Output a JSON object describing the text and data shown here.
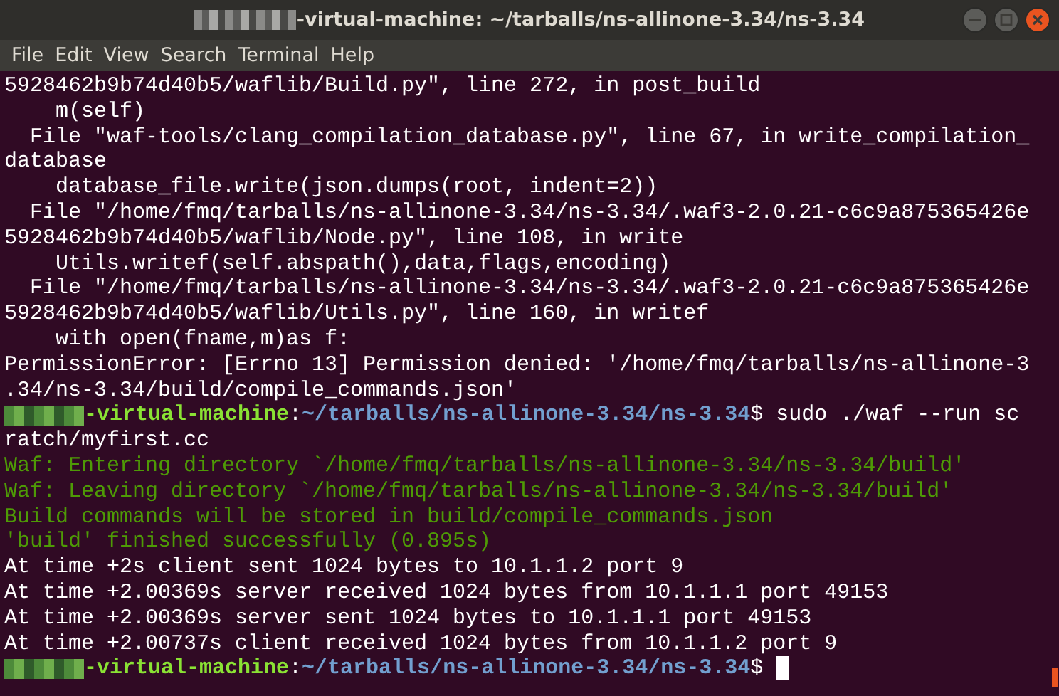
{
  "window": {
    "title": "-virtual-machine: ~/tarballs/ns-allinone-3.34/ns-3.34"
  },
  "menu": [
    "File",
    "Edit",
    "View",
    "Search",
    "Terminal",
    "Help"
  ],
  "terminal": {
    "lines": [
      {
        "kind": "output",
        "text": "5928462b9b74d40b5/waflib/Build.py\", line 272, in post_build"
      },
      {
        "kind": "output",
        "text": "    m(self)"
      },
      {
        "kind": "output",
        "text": "  File \"waf-tools/clang_compilation_database.py\", line 67, in write_compilation_"
      },
      {
        "kind": "output",
        "text": "database"
      },
      {
        "kind": "output",
        "text": "    database_file.write(json.dumps(root, indent=2))"
      },
      {
        "kind": "output",
        "text": "  File \"/home/fmq/tarballs/ns-allinone-3.34/ns-3.34/.waf3-2.0.21-c6c9a875365426e"
      },
      {
        "kind": "output",
        "text": "5928462b9b74d40b5/waflib/Node.py\", line 108, in write"
      },
      {
        "kind": "output",
        "text": "    Utils.writef(self.abspath(),data,flags,encoding)"
      },
      {
        "kind": "output",
        "text": "  File \"/home/fmq/tarballs/ns-allinone-3.34/ns-3.34/.waf3-2.0.21-c6c9a875365426e"
      },
      {
        "kind": "output",
        "text": "5928462b9b74d40b5/waflib/Utils.py\", line 160, in writef"
      },
      {
        "kind": "output",
        "text": "    with open(fname,m)as f:"
      },
      {
        "kind": "output",
        "text": "PermissionError: [Errno 13] Permission denied: '/home/fmq/tarballs/ns-allinone-3"
      },
      {
        "kind": "output",
        "text": ".34/ns-3.34/build/compile_commands.json'"
      },
      {
        "kind": "prompt",
        "host": "-virtual-machine",
        "separator": ":",
        "path": "~/tarballs/ns-allinone-3.34/ns-3.34",
        "command": "$ sudo ./waf --run sc",
        "cursor": false
      },
      {
        "kind": "output",
        "text": "ratch/myfirst.cc"
      },
      {
        "kind": "waf",
        "text": "Waf: Entering directory `/home/fmq/tarballs/ns-allinone-3.34/ns-3.34/build'"
      },
      {
        "kind": "waf",
        "text": "Waf: Leaving directory `/home/fmq/tarballs/ns-allinone-3.34/ns-3.34/build'"
      },
      {
        "kind": "waf",
        "text": "Build commands will be stored in build/compile_commands.json"
      },
      {
        "kind": "waf",
        "text": "'build' finished successfully (0.895s)"
      },
      {
        "kind": "output",
        "text": "At time +2s client sent 1024 bytes to 10.1.1.2 port 9"
      },
      {
        "kind": "output",
        "text": "At time +2.00369s server received 1024 bytes from 10.1.1.1 port 49153"
      },
      {
        "kind": "output",
        "text": "At time +2.00369s server sent 1024 bytes to 10.1.1.1 port 49153"
      },
      {
        "kind": "output",
        "text": "At time +2.00737s client received 1024 bytes from 10.1.1.2 port 9"
      },
      {
        "kind": "prompt",
        "host": "-virtual-machine",
        "separator": ":",
        "path": "~/tarballs/ns-allinone-3.34/ns-3.34",
        "command": "$ ",
        "cursor": true
      }
    ]
  }
}
